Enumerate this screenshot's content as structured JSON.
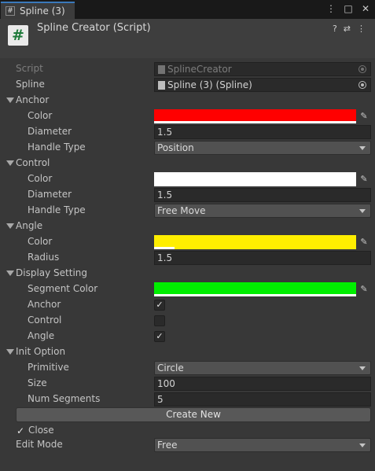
{
  "tab": {
    "label": "Spline (3)",
    "icon": "#"
  },
  "window_icons": {
    "menu": "⋮",
    "maximize": "□",
    "close": "✕"
  },
  "header": {
    "title": "Spline Creator (Script)",
    "icon": "#",
    "tools": {
      "help": "?",
      "settings": "⇄",
      "more": "⋮"
    }
  },
  "fields": {
    "script": {
      "label": "Script",
      "value": "SplineCreator"
    },
    "spline": {
      "label": "Spline",
      "value": "Spline (3) (Spline)"
    }
  },
  "anchor": {
    "header": "Anchor",
    "color_label": "Color",
    "color": "#ff0000",
    "alpha_bar": 1.0,
    "diameter_label": "Diameter",
    "diameter": "1.5",
    "handle_type_label": "Handle Type",
    "handle_type": "Position"
  },
  "control": {
    "header": "Control",
    "color_label": "Color",
    "color": "#ffffff",
    "alpha_bar": 1.0,
    "diameter_label": "Diameter",
    "diameter": "1.5",
    "handle_type_label": "Handle Type",
    "handle_type": "Free Move"
  },
  "angle": {
    "header": "Angle",
    "color_label": "Color",
    "color": "#ffee00",
    "alpha_bar": 0.1,
    "radius_label": "Radius",
    "radius": "1.5"
  },
  "display": {
    "header": "Display Setting",
    "segment_color_label": "Segment Color",
    "segment_color": "#00ee00",
    "alpha_bar": 1.0,
    "anchor_label": "Anchor",
    "anchor_checked": true,
    "control_label": "Control",
    "control_checked": false,
    "angle_label": "Angle",
    "angle_checked": true
  },
  "init": {
    "header": "Init Option",
    "primitive_label": "Primitive",
    "primitive": "Circle",
    "size_label": "Size",
    "size": "100",
    "num_segments_label": "Num Segments",
    "num_segments": "5",
    "create_button": "Create New"
  },
  "close": {
    "label": "Close",
    "checked": true
  },
  "edit_mode": {
    "label": "Edit Mode",
    "value": "Free"
  },
  "icons": {
    "checkmark": "✓",
    "eyedropper": "✎"
  }
}
